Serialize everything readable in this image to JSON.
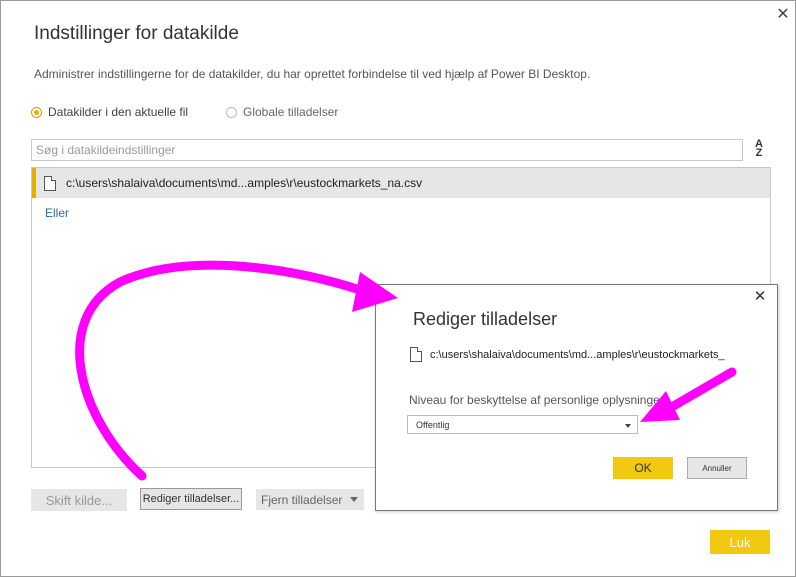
{
  "main": {
    "title": "Indstillinger for datakilde",
    "subtitle": "Administrer indstillingerne for de datakilder, du har oprettet forbindelse til ved hjælp af Power BI Desktop.",
    "radio_current": "Datakilder i den aktuelle fil",
    "radio_global": "Globale tilladelser",
    "search_placeholder": "Søg i datakildeindstillinger",
    "sort_top": "A",
    "sort_bottom": "Z",
    "list_item": "c:\\users\\shalaiva\\documents\\md...amples\\r\\eustockmarkets_na.csv",
    "eller": "Eller",
    "btn_skift": "Skift kilde...",
    "btn_rediger": "Rediger tilladelser...",
    "btn_fjern": "Fjern tilladelser",
    "btn_luk": "Luk",
    "close": "✕"
  },
  "dialog": {
    "title": "Rediger tilladelser",
    "file": "c:\\users\\shalaiva\\documents\\md...amples\\r\\eustockmarkets_",
    "label": "Niveau for beskyttelse af personlige oplysninger",
    "select_value": "Offentlig",
    "btn_ok": "OK",
    "btn_annuller": "Annuller",
    "close": "✕"
  },
  "colors": {
    "accent": "#f2c811",
    "arrow": "#ff00ff",
    "link": "#2a6b9c"
  }
}
